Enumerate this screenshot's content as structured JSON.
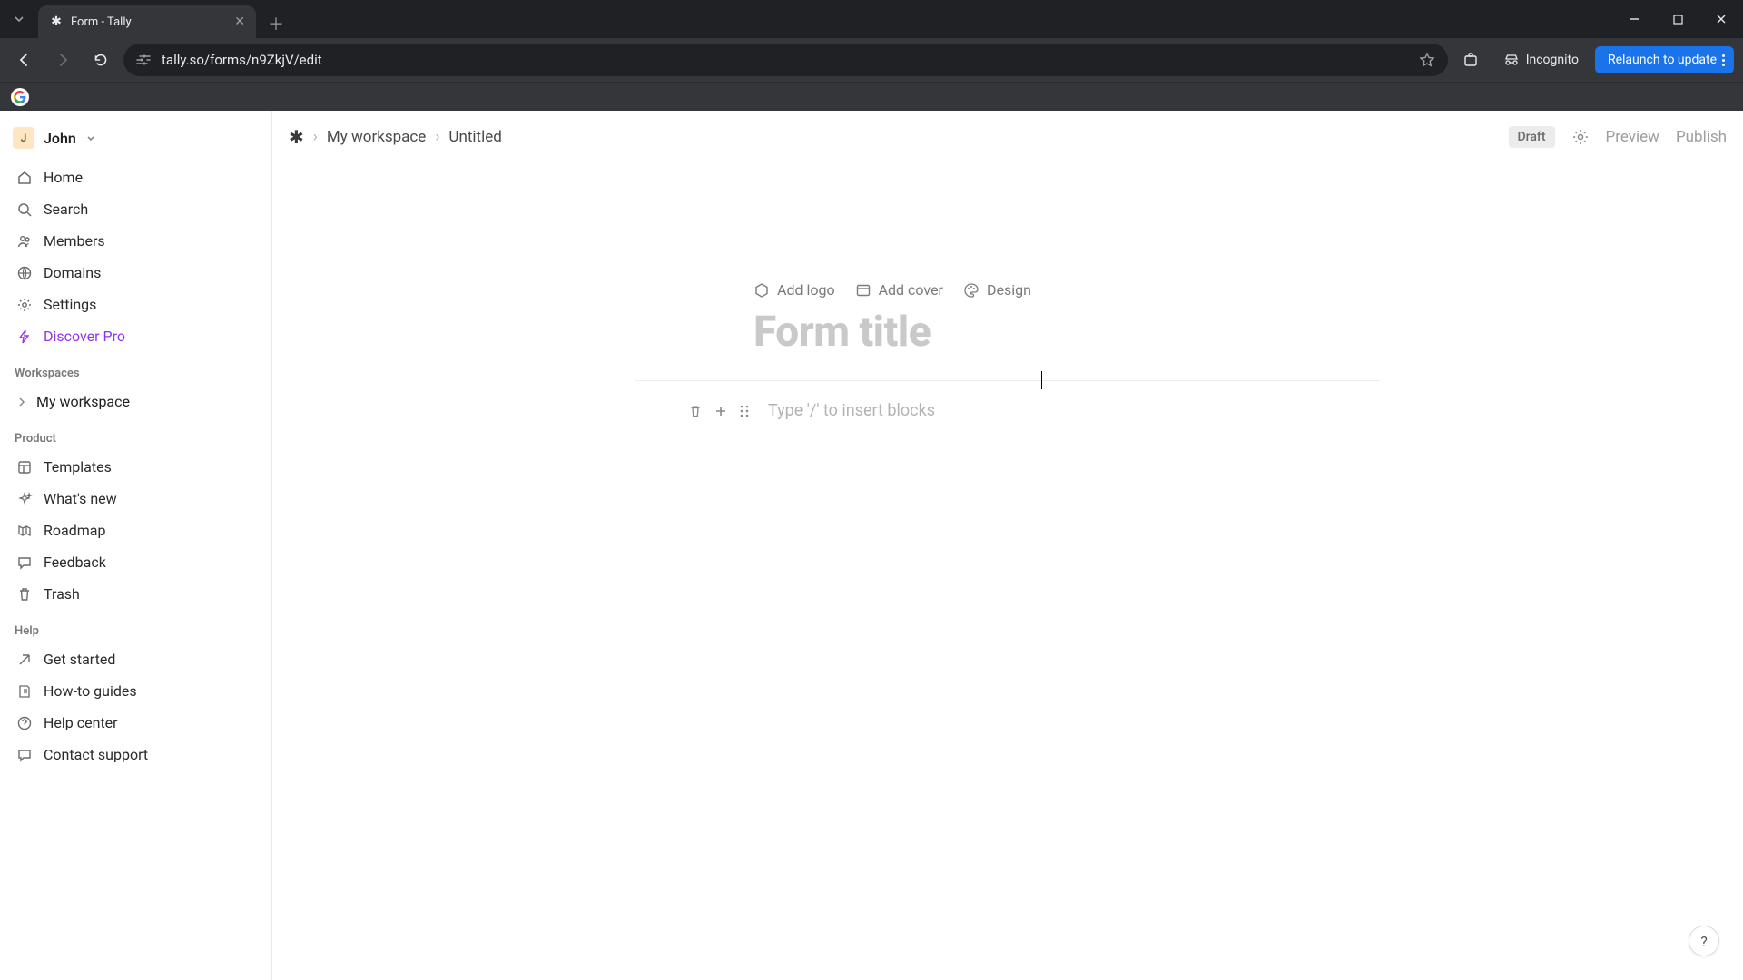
{
  "browser": {
    "tab_title": "Form - Tally",
    "url": "tally.so/forms/n9ZkjV/edit",
    "incognito_label": "Incognito",
    "relaunch_label": "Relaunch to update"
  },
  "user": {
    "initial": "J",
    "name": "John"
  },
  "sidebar": {
    "nav": [
      {
        "label": "Home"
      },
      {
        "label": "Search"
      },
      {
        "label": "Members"
      },
      {
        "label": "Domains"
      },
      {
        "label": "Settings"
      },
      {
        "label": "Discover Pro"
      }
    ],
    "workspaces_header": "Workspaces",
    "workspace": "My workspace",
    "product_header": "Product",
    "product": [
      {
        "label": "Templates"
      },
      {
        "label": "What's new"
      },
      {
        "label": "Roadmap"
      },
      {
        "label": "Feedback"
      },
      {
        "label": "Trash"
      }
    ],
    "help_header": "Help",
    "help": [
      {
        "label": "Get started"
      },
      {
        "label": "How-to guides"
      },
      {
        "label": "Help center"
      },
      {
        "label": "Contact support"
      }
    ]
  },
  "crumbs": {
    "workspace": "My workspace",
    "form": "Untitled"
  },
  "top": {
    "draft": "Draft",
    "preview": "Preview",
    "publish": "Publish"
  },
  "cover": {
    "logo": "Add logo",
    "cover": "Add cover",
    "design": "Design"
  },
  "editor": {
    "title_placeholder": "Form title",
    "block_placeholder": "Type '/' to insert blocks"
  },
  "fab": {
    "help": "?"
  }
}
